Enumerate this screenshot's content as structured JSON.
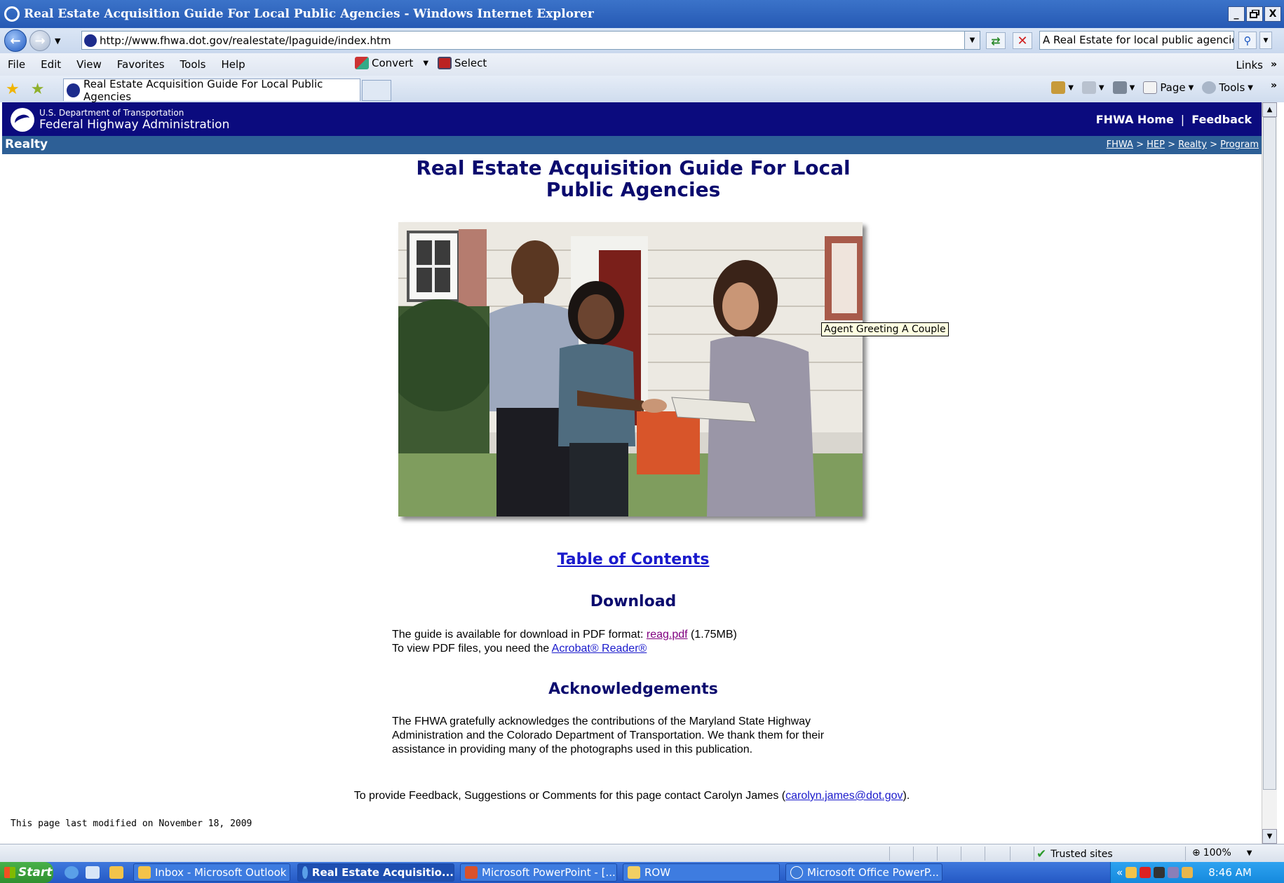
{
  "window": {
    "title": "Real Estate Acquisition Guide For Local Public Agencies - Windows Internet Explorer",
    "minimize": "_",
    "restore": " ",
    "close": "X"
  },
  "addressbar": {
    "url": "http://www.fhwa.dot.gov/realestate/lpaguide/index.htm",
    "search_value": "A Real Estate for local public agencies"
  },
  "menubar": {
    "items": [
      "File",
      "Edit",
      "View",
      "Favorites",
      "Tools",
      "Help"
    ],
    "convert_label": "Convert",
    "select_label": "Select",
    "links_label": "Links"
  },
  "tabbar": {
    "active_tab": "Real Estate Acquisition Guide For Local Public Agencies",
    "page_label": "Page",
    "tools_label": "Tools"
  },
  "site": {
    "dept": "U.S. Department of Transportation",
    "agency": "Federal Highway Administration",
    "home_link": "FHWA Home",
    "feedback_link": "Feedback",
    "section": "Realty",
    "breadcrumbs": [
      "FHWA",
      "HEP",
      "Realty",
      "Program"
    ]
  },
  "content": {
    "title": "Real Estate Acquisition Guide For Local Public Agencies",
    "photo_tooltip": "Agent Greeting A Couple",
    "toc_link": "Table of Contents",
    "download_heading": "Download",
    "download_line1_pre": "The guide is available for download in PDF format: ",
    "download_pdf_link": "reag.pdf",
    "download_line1_post": " (1.75MB)",
    "download_line2_pre": "To view PDF files, you need the ",
    "reader_link": "Acrobat® Reader®",
    "ack_heading": "Acknowledgements",
    "ack_text": "The FHWA gratefully acknowledges the contributions of the Maryland State Highway Administration and the Colorado Department of Transportation. We thank them for their assistance in providing many of the photographs used in this publication.",
    "feedback_pre": "To provide Feedback, Suggestions or Comments for this page contact Carolyn James (",
    "feedback_email": "carolyn.james@dot.gov",
    "feedback_post": ").",
    "modified": "This page last modified on November 18, 2009"
  },
  "statusbar": {
    "zone": "Trusted sites",
    "zoom": "100%"
  },
  "taskbar": {
    "start": "Start",
    "tasks": [
      "Inbox - Microsoft Outlook",
      "Real Estate Acquisitio...",
      "Microsoft PowerPoint - [...",
      "ROW",
      "Microsoft Office PowerP..."
    ],
    "clock": "8:46 AM"
  },
  "colors": {
    "banner": "#0b0b7e",
    "realty_bar": "#2d5f96",
    "heading": "#0b0b6e",
    "link": "#1a1acc",
    "visited_link": "#800080"
  }
}
